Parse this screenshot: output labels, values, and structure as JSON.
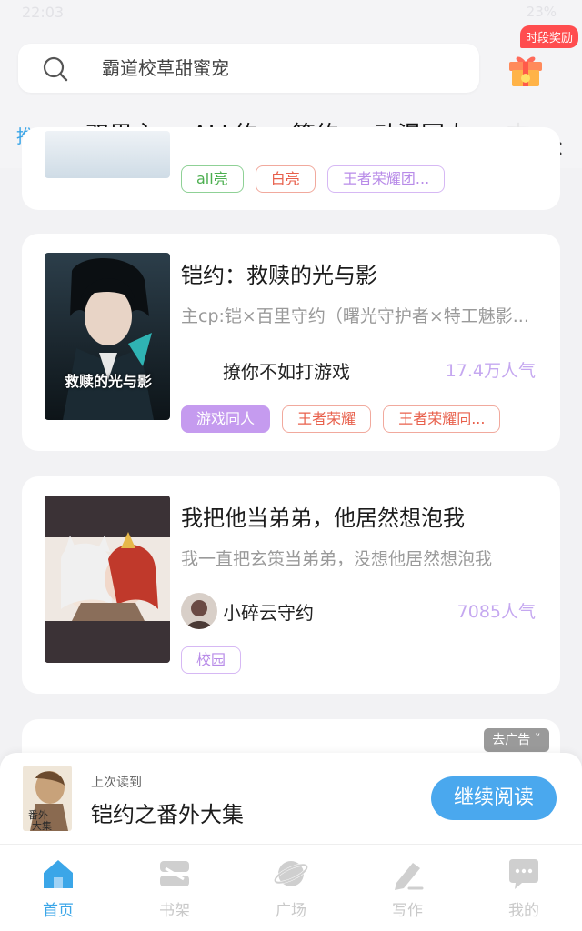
{
  "status_bar": {
    "time": "22:03",
    "battery": "23%"
  },
  "search": {
    "placeholder": "霸道校草甜蜜宠"
  },
  "reward": {
    "badge": "时段奖励"
  },
  "tabs": [
    {
      "label": "推荐",
      "active": true
    },
    {
      "label": "双男主"
    },
    {
      "label": "ALL约"
    },
    {
      "label": "策约"
    },
    {
      "label": "动漫同人"
    },
    {
      "label": "古"
    }
  ],
  "cards": [
    {
      "tags": [
        {
          "label": "all亮",
          "style": "green"
        },
        {
          "label": "白亮",
          "style": "red"
        },
        {
          "label": "王者荣耀团...",
          "style": "purple"
        }
      ]
    },
    {
      "title": "铠约：救赎的光与影",
      "description": "主cp:铠×百里守约（曙光守护者×特工魅影...",
      "author": "撩你不如打游戏",
      "popularity": "17.4万人气",
      "cover_text": "救赎的光与影",
      "tags": [
        {
          "label": "游戏同人",
          "style": "filled"
        },
        {
          "label": "王者荣耀",
          "style": "red"
        },
        {
          "label": "王者荣耀同...",
          "style": "red"
        }
      ]
    },
    {
      "title": "我把他当弟弟，他居然想泡我",
      "description": "我一直把玄策当弟弟，没想他居然想泡我",
      "author": "小碎云守约",
      "popularity": "7085人气",
      "tags": [
        {
          "label": "校园",
          "style": "purple"
        }
      ]
    }
  ],
  "ad": {
    "label": "去广告 ˅"
  },
  "continue_reading": {
    "label": "上次读到",
    "title": "铠约之番外大集",
    "button": "继续阅读"
  },
  "bottom_nav": [
    {
      "label": "首页",
      "icon": "home-icon",
      "active": true
    },
    {
      "label": "书架",
      "icon": "bookshelf-icon"
    },
    {
      "label": "广场",
      "icon": "planet-icon"
    },
    {
      "label": "写作",
      "icon": "pen-icon"
    },
    {
      "label": "我的",
      "icon": "chat-bubble-icon"
    }
  ],
  "colors": {
    "accent": "#3ba6e8",
    "popularity": "#c5a8f0",
    "button": "#4aa8ee",
    "badge": "#ff4d4f"
  }
}
